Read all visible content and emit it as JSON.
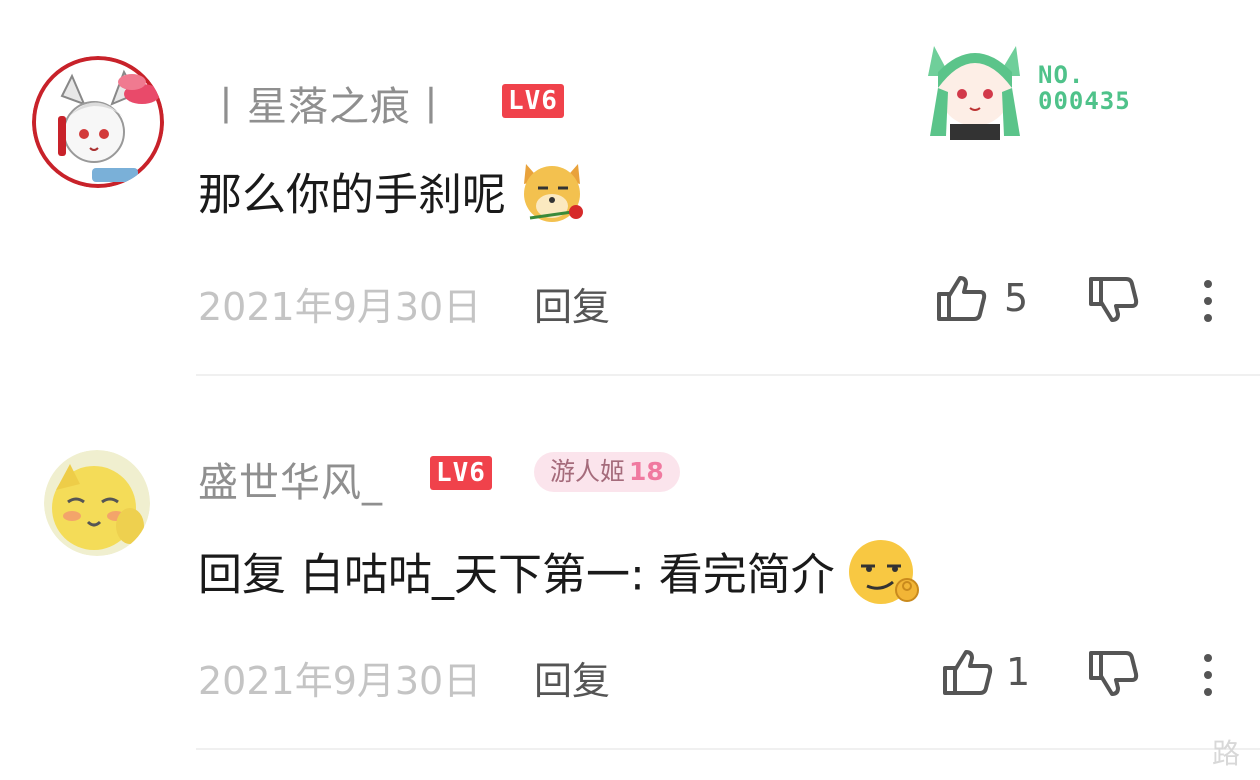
{
  "comments": [
    {
      "username": "丨星落之痕丨",
      "level": "LV6",
      "text": "那么你的手刹呢",
      "emoji": "doge-with-rose",
      "date": "2021年9月30日",
      "reply_label": "回复",
      "likes": "5",
      "fan_badge": {
        "label": "NO.",
        "number": "000435"
      }
    },
    {
      "username": "盛世华风_",
      "level": "LV6",
      "medal": {
        "name": "游人姬",
        "level": "18"
      },
      "text": "回复 白咕咕_天下第一: 看完简介",
      "emoji": "smirk-ok-hand",
      "date": "2021年9月30日",
      "reply_label": "回复",
      "likes": "1"
    }
  ],
  "watermark": "路",
  "colors": {
    "level_badge": "#f0424b",
    "fan_number": "#4fc28a",
    "medal_bg": "#fbe4ec"
  }
}
